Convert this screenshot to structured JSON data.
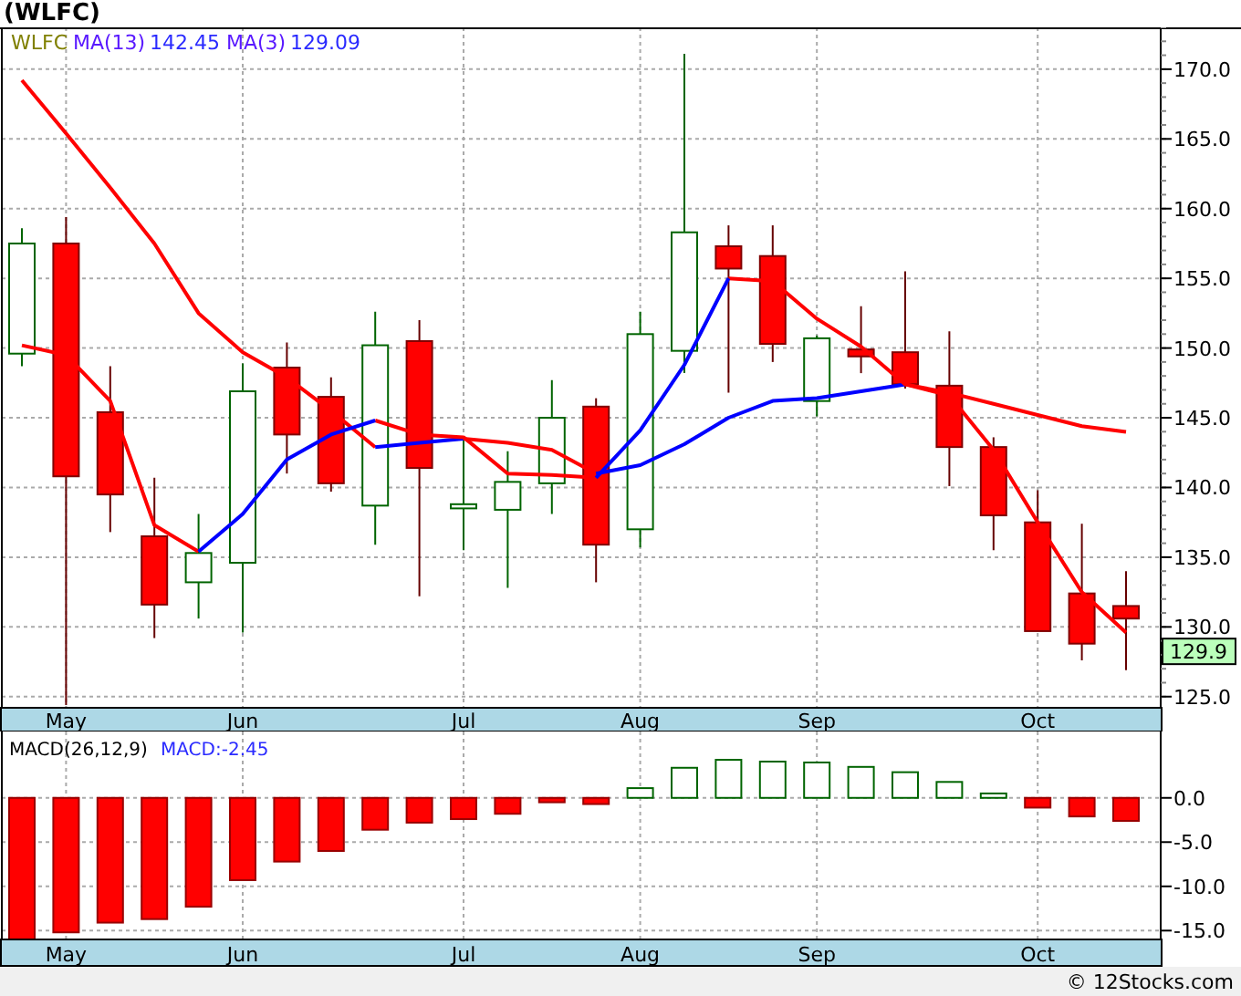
{
  "title": "(WLFC)",
  "price_chart": {
    "legend": [
      {
        "label": "MA(13)",
        "value": "142.45"
      },
      {
        "label": "MA(3)",
        "value": "129.09"
      }
    ],
    "price_tag": "129.9",
    "chart_data": {
      "type": "candlestick",
      "title": "WLFC",
      "grid": true,
      "categories": [
        null,
        "May",
        null,
        null,
        null,
        "Jun",
        null,
        null,
        null,
        null,
        "Jul",
        null,
        null,
        null,
        "Aug",
        null,
        null,
        null,
        "Sep",
        null,
        null,
        null,
        null,
        "Oct",
        null,
        null
      ],
      "ylim": [
        124.2,
        173.0
      ],
      "yticks": [
        {
          "value": 125,
          "label": "125.0"
        },
        {
          "value": 130,
          "label": "130.0"
        },
        {
          "value": 135,
          "label": "135.0"
        },
        {
          "value": 140,
          "label": "140.0"
        },
        {
          "value": 145,
          "label": "145.0"
        },
        {
          "value": 150,
          "label": "150.0"
        },
        {
          "value": 155,
          "label": "155.0"
        },
        {
          "value": 160,
          "label": "160.0"
        },
        {
          "value": 165,
          "label": "165.0"
        },
        {
          "value": 170,
          "label": "170.0"
        }
      ],
      "ohlc": [
        [
          149.6,
          158.6,
          148.7,
          157.5
        ],
        [
          157.5,
          159.4,
          124.4,
          140.8
        ],
        [
          145.4,
          148.7,
          136.8,
          139.5
        ],
        [
          136.5,
          140.7,
          129.2,
          131.6
        ],
        [
          133.2,
          138.1,
          130.6,
          135.3
        ],
        [
          134.6,
          148.9,
          129.6,
          146.9
        ],
        [
          148.6,
          150.4,
          141.0,
          143.8
        ],
        [
          146.5,
          147.9,
          139.7,
          140.3
        ],
        [
          138.7,
          152.6,
          135.9,
          150.2
        ],
        [
          150.5,
          152.0,
          132.2,
          141.4
        ],
        [
          138.5,
          143.6,
          135.5,
          138.8
        ],
        [
          138.4,
          142.6,
          132.8,
          140.4
        ],
        [
          140.3,
          147.7,
          138.1,
          145.0
        ],
        [
          145.8,
          146.4,
          133.2,
          135.9
        ],
        [
          137.0,
          152.6,
          135.7,
          151.0
        ],
        [
          149.8,
          171.1,
          148.2,
          158.3
        ],
        [
          157.3,
          158.8,
          146.8,
          155.7
        ],
        [
          156.6,
          158.8,
          149.0,
          150.3
        ],
        [
          146.2,
          150.9,
          145.1,
          150.7
        ],
        [
          149.9,
          153.0,
          148.2,
          149.4
        ],
        [
          149.7,
          155.5,
          147.1,
          147.4
        ],
        [
          147.3,
          151.2,
          140.1,
          142.9
        ],
        [
          142.9,
          143.6,
          135.5,
          138.0
        ],
        [
          137.5,
          139.8,
          129.7,
          129.7
        ],
        [
          132.4,
          137.4,
          127.6,
          128.8
        ],
        [
          131.5,
          134.0,
          126.9,
          130.6
        ]
      ],
      "series": [
        {
          "type": "line",
          "color": "#ff0000",
          "values": [
            169.2,
            165.4,
            161.5,
            157.5,
            152.5,
            149.7,
            147.9,
            145.5,
            142.9,
            null,
            143.5,
            143.2,
            142.7,
            141.0,
            null,
            null,
            null,
            null,
            null,
            null,
            147.4,
            146.8,
            146.0,
            145.2,
            144.4,
            144.0
          ]
        },
        {
          "type": "line",
          "color": "#0000ff",
          "values": [
            null,
            null,
            null,
            null,
            null,
            null,
            null,
            null,
            142.9,
            143.2,
            143.5,
            null,
            null,
            141.0,
            141.6,
            143.1,
            145.0,
            146.2,
            146.4,
            146.9,
            147.4,
            null,
            null,
            null,
            null,
            null
          ]
        },
        {
          "type": "line",
          "color": "#ff0000",
          "values": [
            150.2,
            149.5,
            146.2,
            137.3,
            135.4,
            null,
            null,
            null,
            144.8,
            143.8,
            143.6,
            141.0,
            140.9,
            140.7,
            null,
            null,
            155.0,
            154.8,
            152.1,
            150.1,
            147.4,
            146.6,
            142.7,
            137.5,
            132.5,
            129.6
          ]
        },
        {
          "type": "line",
          "color": "#0000ff",
          "values": [
            null,
            null,
            null,
            null,
            135.4,
            138.1,
            142.0,
            143.8,
            144.8,
            null,
            null,
            null,
            null,
            140.7,
            144.1,
            148.8,
            155.0,
            null,
            null,
            null,
            null,
            null,
            null,
            null,
            null,
            null
          ]
        }
      ]
    }
  },
  "macd_chart": {
    "value_label": "MACD:-2.45",
    "chart_data": {
      "type": "bar",
      "title": "MACD(26,12,9)",
      "grid": true,
      "categories": [
        null,
        "May",
        null,
        null,
        null,
        "Jun",
        null,
        null,
        null,
        null,
        "Jul",
        null,
        null,
        null,
        "Aug",
        null,
        null,
        null,
        "Sep",
        null,
        null,
        null,
        null,
        "Oct",
        null,
        null
      ],
      "ylim": [
        -16.0,
        7.5
      ],
      "yticks": [
        {
          "value": 0,
          "label": "0.0"
        },
        {
          "value": -5,
          "label": "-5.0"
        },
        {
          "value": -10,
          "label": "-10.0"
        },
        {
          "value": -15,
          "label": "-15.0"
        }
      ],
      "values": [
        -16.0,
        -15.2,
        -14.1,
        -13.7,
        -12.3,
        -9.3,
        -7.2,
        -6.0,
        -3.6,
        -2.8,
        -2.4,
        -1.8,
        -0.5,
        -0.7,
        1.1,
        3.4,
        4.3,
        4.1,
        4.0,
        3.5,
        2.9,
        1.8,
        0.5,
        -1.1,
        -2.1,
        -2.6
      ]
    }
  },
  "footer": "© 12Stocks.com"
}
